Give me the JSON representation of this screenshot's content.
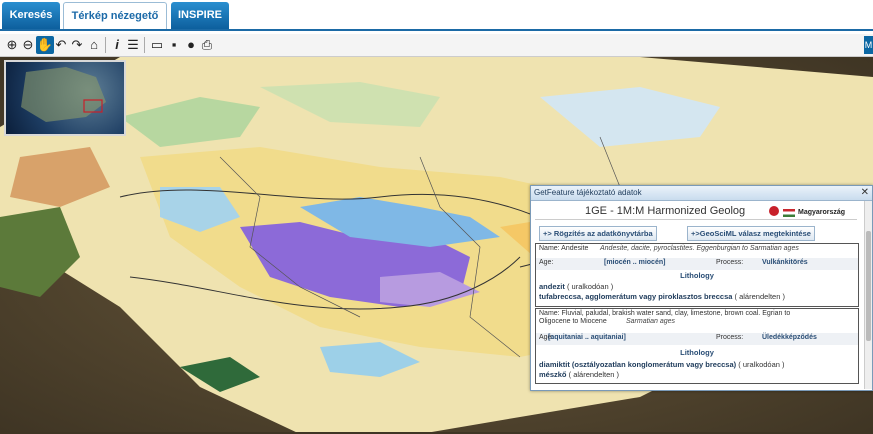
{
  "tabs": [
    {
      "label": "Keresés",
      "active": false
    },
    {
      "label": "Térkép nézegető",
      "active": true
    },
    {
      "label": "INSPIRE",
      "active": false
    }
  ],
  "toolbar": {
    "right_label": "M",
    "icons": [
      "zoom-in-icon",
      "zoom-out-icon",
      "pan-hand-icon",
      "undo-icon",
      "redo-icon",
      "home-icon",
      "info-icon",
      "legend-list-icon",
      "folder-open-icon",
      "save-icon",
      "globe-icon",
      "print-icon"
    ]
  },
  "popup": {
    "title": "GetFeature tájékoztató adatok",
    "layer": "1GE - 1M:M Harmonized Geolog",
    "country": "Magyarország",
    "btn_record": "+> Rögzítés az adatkönyvtárba",
    "btn_geosciml": "+>GeoSciML válasz megtekintése",
    "records": [
      {
        "name_key": "Name: Andesite",
        "name_value": "Andesite, dacite, pyroclastites. Eggenburgian to Sarmatian ages",
        "age_key": "Age:",
        "age_value": "[miocén .. miocén]",
        "process_key": "Process:",
        "process_value": "Vulkánkitörés",
        "section": "Lithology",
        "lith": [
          {
            "name": "andezit",
            "note": "( uralkodóan )"
          },
          {
            "name": "tufabreccsa, agglomerátum vagy piroklasztos breccsa",
            "note": "( alárendelten )"
          }
        ]
      },
      {
        "name_key": "Name: Fluvial, paludal, brakish water sand, clay, limestone, brown coal. Egrian to",
        "name_key2": "Oligocene to Miocene",
        "name_value": "Sarmatian ages",
        "age_key": "Age:",
        "age_value": "[aquitaniai .. aquitaniai]",
        "process_key": "Process:",
        "process_value": "Üledékképződés",
        "section": "Lithology",
        "lith": [
          {
            "name": "diamiktit (osztályozatlan konglomerátum vagy breccsa)",
            "note": "( uralkodóan )"
          },
          {
            "name": "mészkő",
            "note": "( alárendelten )"
          }
        ]
      }
    ]
  }
}
